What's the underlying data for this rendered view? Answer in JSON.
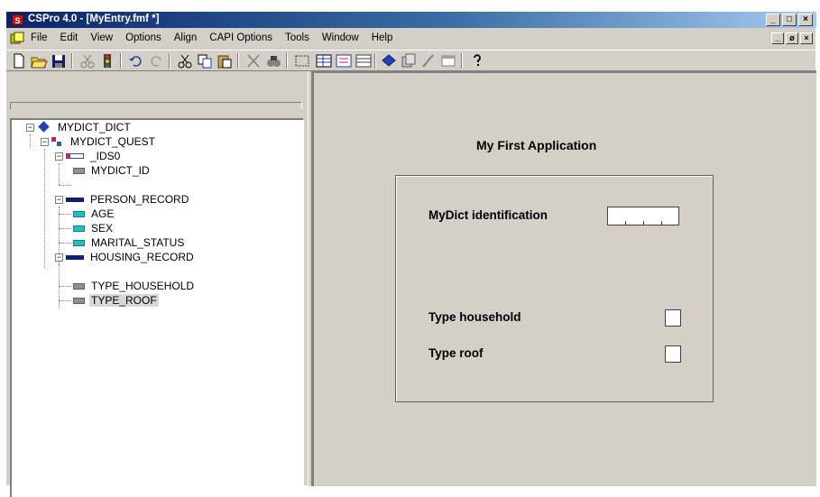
{
  "window": {
    "app_icon_letter": "S",
    "title": "CSPro 4.0 - [MyEntry.fmf *]",
    "controls": [
      "_",
      "□",
      "×"
    ],
    "mdi_controls": [
      "_",
      "ø",
      "×"
    ]
  },
  "menu": {
    "items": [
      "File",
      "Edit",
      "View",
      "Options",
      "Align",
      "CAPI Options",
      "Tools",
      "Window",
      "Help"
    ]
  },
  "toolbar": {
    "icons": [
      "new-icon",
      "open-icon",
      "save-icon",
      "scissors-icon",
      "generate-icon",
      "undo-icon",
      "redo-icon",
      "cut-icon",
      "copy-icon",
      "paste-icon",
      "delete-icon",
      "find-icon",
      "select-icon",
      "roster-icon",
      "form-icon",
      "list-icon",
      "dictionary-icon",
      "forms-icon",
      "edit-icon",
      "window-icon",
      "help-icon"
    ]
  },
  "tree": {
    "nodes": [
      {
        "label": "MYDICT_DICT",
        "icon": "dictionary-icon"
      },
      {
        "label": "MYDICT_QUEST",
        "icon": "questionnaire-icon"
      },
      {
        "label": "_IDS0",
        "icon": "id-record-icon"
      },
      {
        "label": "MYDICT_ID",
        "icon": "item-icon"
      },
      {
        "label": "PERSON_RECORD",
        "icon": "record-icon"
      },
      {
        "label": "AGE",
        "icon": "item-cyan-icon"
      },
      {
        "label": "SEX",
        "icon": "item-cyan-icon"
      },
      {
        "label": "MARITAL_STATUS",
        "icon": "item-cyan-icon"
      },
      {
        "label": "HOUSING_RECORD",
        "icon": "record-icon"
      },
      {
        "label": "TYPE_HOUSEHOLD",
        "icon": "item-icon"
      },
      {
        "label": "TYPE_ROOF",
        "icon": "item-icon"
      }
    ]
  },
  "form": {
    "title": "My First Application",
    "fields": {
      "id_label": "MyDict identification",
      "household_label": "Type household",
      "roof_label": "Type roof"
    }
  }
}
